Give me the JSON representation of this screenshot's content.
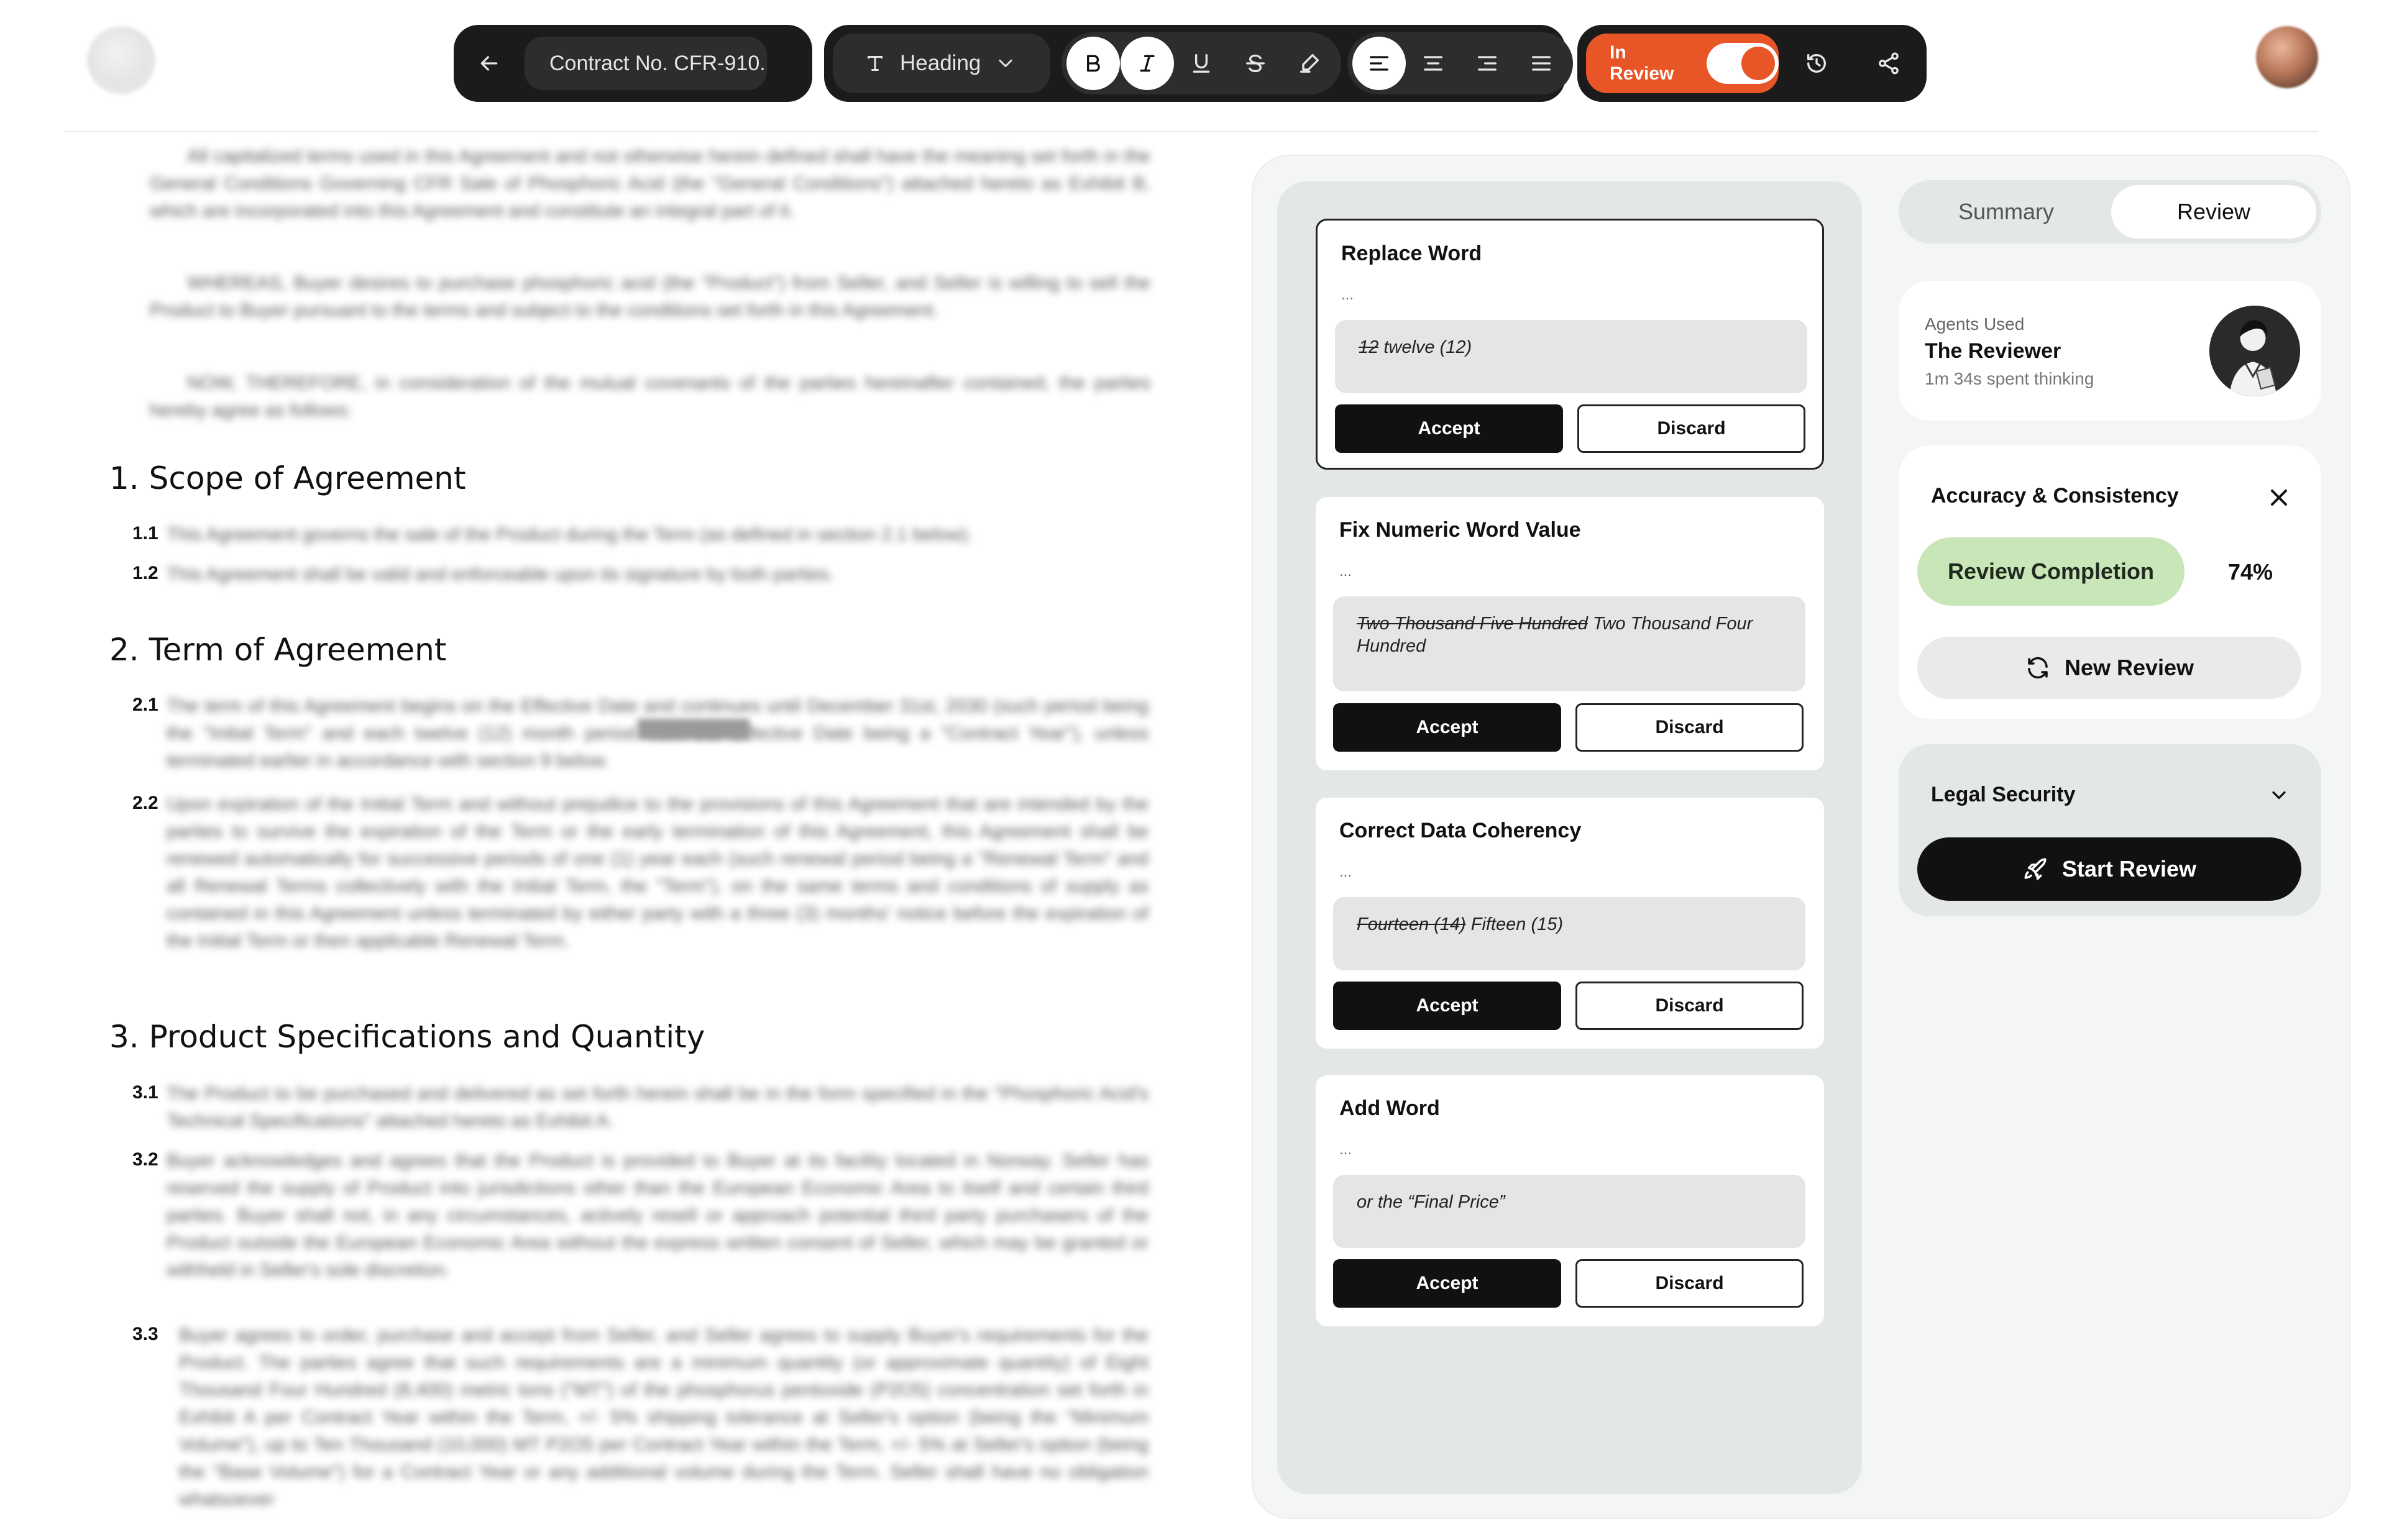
{
  "toolbar": {
    "document_title": "Contract No. CFR-910...",
    "text_style": "Heading",
    "review_toggle_label": "In Review"
  },
  "document": {
    "intro_paragraphs": [
      "All capitalized terms used in this Agreement and not otherwise herein defined shall have the meaning set forth in the General Conditions Governing CFR Sale of Phosphoric Acid (the \"General Conditions\") attached hereto as Exhibit B, which are incorporated into this Agreement and constitute an integral part of it.",
      "WHEREAS, Buyer desires to purchase phosphoric acid (the \"Product\") from Seller, and Seller is willing to sell the Product to Buyer pursuant to the terms and subject to the conditions set forth in this Agreement.",
      "NOW, THEREFORE, in consideration of the mutual covenants of the parties hereinafter contained, the parties hereby agree as follows:"
    ],
    "sections": [
      {
        "heading": "1. Scope of Agreement",
        "clauses": [
          {
            "num": "1.1",
            "text": "This Agreement governs the sale of the Product during the Term (as defined in section 2.1 below)."
          },
          {
            "num": "1.2",
            "text": "This Agreement shall be valid and enforceable upon its signature by both parties."
          }
        ]
      },
      {
        "heading": "2. Term of Agreement",
        "clauses": [
          {
            "num": "2.1",
            "text": "The term of this Agreement begins on the Effective Date and continues until December 31st, 2030 (such period being the \"Initial Term\" and each twelve (12) month period from the Effective Date being a \"Contract Year\"), unless terminated earlier in accordance with section 9 below."
          },
          {
            "num": "2.2",
            "text": "Upon expiration of the Initial Term and without prejudice to the provisions of this Agreement that are intended by the parties to survive the expiration of the Term or the early termination of this Agreement, this Agreement shall be renewed automatically for successive periods of one (1) year each (such renewal period being a \"Renewal Term\" and all Renewal Terms collectively with the Initial Term, the \"Term\"), on the same terms and conditions of supply as contained in this Agreement unless terminated by either party with a three (3) months' notice before the expiration of the Initial Term or then applicable Renewal Term."
          }
        ]
      },
      {
        "heading": "3. Product Specifications and Quantity",
        "clauses": [
          {
            "num": "3.1",
            "text": "The Product to be purchased and delivered as set forth herein shall be in the form specified in the \"Phosphoric Acid's Technical Specifications\" attached hereto as Exhibit A."
          },
          {
            "num": "3.2",
            "text": "Buyer acknowledges and agrees that the Product is provided to Buyer at its facility located in Norway. Seller has reserved the supply of Product into jurisdictions other than the European Economic Area to itself and certain third parties. Buyer shall not, in any circumstances, actively resell or approach potential third party purchasers of the Product outside the European Economic Area without the express written consent of Seller, which may be granted or withheld in Seller's sole discretion."
          },
          {
            "num": "3.3",
            "text": "Buyer agrees to order, purchase and accept from Seller, and Seller agrees to supply Buyer's requirements for the Product. The parties agree that such requirements are a minimum quantity (or approximate quantity) of Eight Thousand Four Hundred (8,400) metric tons (\"MT\") of the phosphorus pentoxide (P2O5) concentration set forth in Exhibit A per Contract Year within the Term, +/- 5% shipping tolerance at Seller's option (being the \"Minimum Volume\"), up to Ten Thousand (10,000) MT P2O5 per Contract Year within the Term, +/- 5% at Seller's option (being the \"Base Volume\") for a Contract Year or any additional volume during the Term. Seller shall have no obligation whatsoever"
          }
        ]
      }
    ]
  },
  "suggestions": [
    {
      "title": "Replace Word",
      "ellipsis": "...",
      "old": "12",
      "new": "twelve (12)",
      "accept": "Accept",
      "discard": "Discard"
    },
    {
      "title": "Fix Numeric Word Value",
      "ellipsis": "...",
      "old": "Two Thousand Five Hundred",
      "new": "Two Thousand Four Hundred",
      "accept": "Accept",
      "discard": "Discard"
    },
    {
      "title": "Correct Data Coherency",
      "ellipsis": "...",
      "old": "Fourteen (14)",
      "new": "Fifteen (15)",
      "accept": "Accept",
      "discard": "Discard"
    },
    {
      "title": "Add Word",
      "ellipsis": "...",
      "old": "",
      "new": "or the “Final Price”",
      "accept": "Accept",
      "discard": "Discard"
    }
  ],
  "side_panel": {
    "tabs": [
      "Summary",
      "Review"
    ],
    "active_tab": "Review",
    "agents": {
      "label": "Agents Used",
      "name": "The Reviewer",
      "time": "1m 34s spent thinking"
    },
    "accuracy": {
      "title": "Accuracy & Consistency",
      "completion_label": "Review Completion",
      "completion_pct": "74%",
      "new_review": "New Review"
    },
    "legal": {
      "title": "Legal Security",
      "start_review": "Start Review"
    }
  },
  "colors": {
    "accent": "#e85527",
    "completion": "#c9e6b8",
    "dark": "#1b1b1b"
  },
  "icons": [
    "back-arrow-icon",
    "text-style-icon",
    "chevron-down-icon",
    "bold-icon",
    "italic-icon",
    "underline-icon",
    "strikethrough-icon",
    "highlighter-icon",
    "align-left-icon",
    "align-center-icon",
    "align-right-icon",
    "align-justify-icon",
    "history-icon",
    "share-icon",
    "close-icon",
    "refresh-icon",
    "rocket-icon"
  ]
}
